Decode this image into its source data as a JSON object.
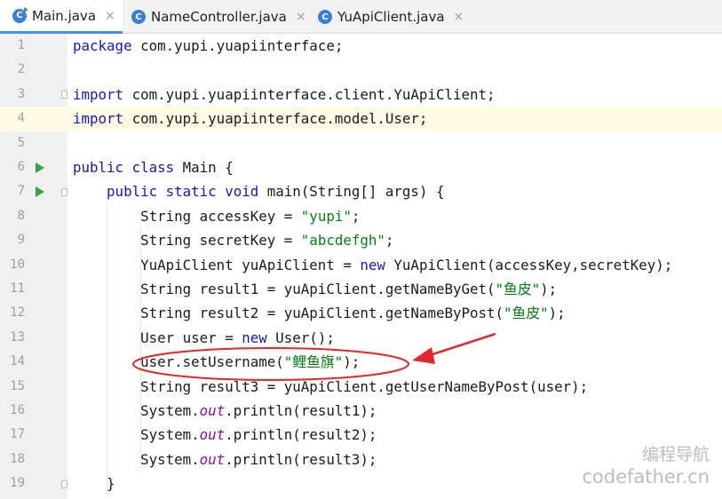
{
  "tabs": [
    {
      "label": "Main.java",
      "close": "×",
      "active": true
    },
    {
      "label": "NameController.java",
      "close": "×",
      "active": false
    },
    {
      "label": "YuApiClient.java",
      "close": "×",
      "active": false
    }
  ],
  "tab_icon_letter": "C",
  "line_numbers": [
    "1",
    "2",
    "3",
    "4",
    "5",
    "6",
    "7",
    "8",
    "9",
    "10",
    "11",
    "12",
    "13",
    "14",
    "15",
    "16",
    "17",
    "18",
    "19"
  ],
  "code_lines": [
    [
      {
        "t": "package ",
        "c": "kw"
      },
      {
        "t": "com.yupi.yuapiinterface;"
      }
    ],
    [],
    [
      {
        "t": "import ",
        "c": "kw"
      },
      {
        "t": "com.yupi.yuapiinterface.client.YuApiClient;"
      }
    ],
    [
      {
        "t": "import ",
        "c": "kw"
      },
      {
        "t": "com.yupi.yuapiinterface.model.User;"
      }
    ],
    [],
    [
      {
        "t": "public class ",
        "c": "kw"
      },
      {
        "t": "Main {"
      }
    ],
    [
      {
        "t": "    "
      },
      {
        "t": "public static void ",
        "c": "kw"
      },
      {
        "t": "main(String[] args) {"
      }
    ],
    [
      {
        "t": "        String accessKey = "
      },
      {
        "t": "\"yupi\"",
        "c": "str"
      },
      {
        "t": ";"
      }
    ],
    [
      {
        "t": "        String secretKey = "
      },
      {
        "t": "\"abcdefgh\"",
        "c": "str"
      },
      {
        "t": ";"
      }
    ],
    [
      {
        "t": "        YuApiClient yuApiClient = "
      },
      {
        "t": "new ",
        "c": "kw"
      },
      {
        "t": "YuApiClient(accessKey,secretKey);"
      }
    ],
    [
      {
        "t": "        String result1 = yuApiClient.getNameByGet("
      },
      {
        "t": "\"鱼皮\"",
        "c": "str"
      },
      {
        "t": ");"
      }
    ],
    [
      {
        "t": "        String result2 = yuApiClient.getNameByPost("
      },
      {
        "t": "\"鱼皮\"",
        "c": "str"
      },
      {
        "t": ");"
      }
    ],
    [
      {
        "t": "        User user = "
      },
      {
        "t": "new ",
        "c": "kw"
      },
      {
        "t": "User();"
      }
    ],
    [
      {
        "t": "        user.setUsername("
      },
      {
        "t": "\"鲤鱼旗\"",
        "c": "str"
      },
      {
        "t": ");"
      }
    ],
    [
      {
        "t": "        String result3 = yuApiClient.getUserNameByPost(user);"
      }
    ],
    [
      {
        "t": "        System."
      },
      {
        "t": "out",
        "c": "fld"
      },
      {
        "t": ".println(result1);"
      }
    ],
    [
      {
        "t": "        System."
      },
      {
        "t": "out",
        "c": "fld"
      },
      {
        "t": ".println(result2);"
      }
    ],
    [
      {
        "t": "        System."
      },
      {
        "t": "out",
        "c": "fld"
      },
      {
        "t": ".println(result3);"
      }
    ],
    [
      {
        "t": "    }"
      }
    ]
  ],
  "highlighted_line": "4",
  "run_gutter_lines": [
    "6",
    "7"
  ],
  "fold_marker_lines": [
    "3",
    "7",
    "19"
  ],
  "annotation": {
    "shape": "ellipse",
    "color": "#e0282e",
    "target_line": "14"
  },
  "watermark": {
    "line1": "编程导航",
    "line2": "codefather.cn"
  },
  "colors": {
    "keyword": "#1a1aa6",
    "string": "#067d17",
    "field": "#871094",
    "tab_underline": "#4a8ff0",
    "run_icon": "#3aa04a",
    "annotation": "#e0282e"
  }
}
